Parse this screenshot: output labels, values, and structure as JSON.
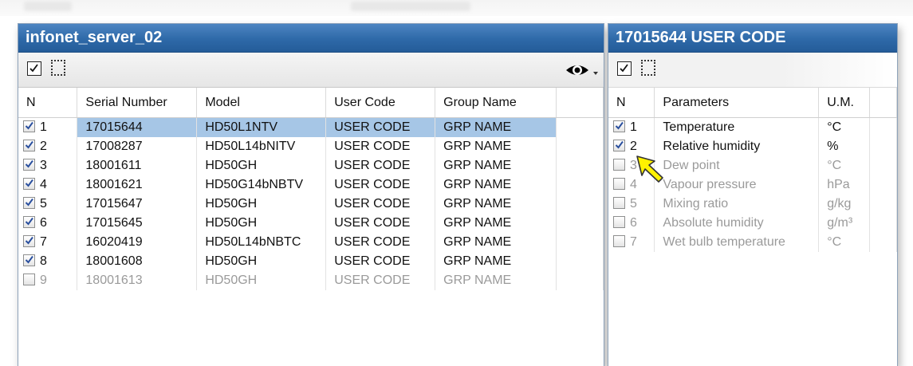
{
  "server_panel": {
    "title": "infonet_server_02",
    "columns": [
      "N",
      "Serial Number",
      "Model",
      "User Code",
      "Group Name"
    ],
    "rows": [
      {
        "n": "1",
        "checked": true,
        "serial": "17015644",
        "model": "HD50L1NTV",
        "user_code": "USER CODE",
        "group": "GRP NAME"
      },
      {
        "n": "2",
        "checked": true,
        "serial": "17008287",
        "model": "HD50L14bNITV",
        "user_code": "USER CODE",
        "group": "GRP NAME"
      },
      {
        "n": "3",
        "checked": true,
        "serial": "18001611",
        "model": "HD50GH",
        "user_code": "USER CODE",
        "group": "GRP NAME"
      },
      {
        "n": "4",
        "checked": true,
        "serial": "18001621",
        "model": "HD50G14bNBTV",
        "user_code": "USER CODE",
        "group": "GRP NAME"
      },
      {
        "n": "5",
        "checked": true,
        "serial": "17015647",
        "model": "HD50GH",
        "user_code": "USER CODE",
        "group": "GRP NAME"
      },
      {
        "n": "6",
        "checked": true,
        "serial": "17015645",
        "model": "HD50GH",
        "user_code": "USER CODE",
        "group": "GRP NAME"
      },
      {
        "n": "7",
        "checked": true,
        "serial": "16020419",
        "model": "HD50L14bNBTC",
        "user_code": "USER CODE",
        "group": "GRP NAME"
      },
      {
        "n": "8",
        "checked": true,
        "serial": "18001608",
        "model": "HD50GH",
        "user_code": "USER CODE",
        "group": "GRP NAME"
      },
      {
        "n": "9",
        "checked": false,
        "serial": "18001613",
        "model": "HD50GH",
        "user_code": "USER CODE",
        "group": "GRP NAME"
      }
    ]
  },
  "device_panel": {
    "title": "17015644 USER CODE",
    "columns": [
      "N",
      "Parameters",
      "U.M."
    ],
    "rows": [
      {
        "n": "1",
        "checked": true,
        "param": "Temperature",
        "unit": "°C"
      },
      {
        "n": "2",
        "checked": true,
        "param": "Relative humidity",
        "unit": "%"
      },
      {
        "n": "3",
        "checked": false,
        "param": "Dew point",
        "unit": "°C"
      },
      {
        "n": "4",
        "checked": false,
        "param": "Vapour pressure",
        "unit": "hPa"
      },
      {
        "n": "5",
        "checked": false,
        "param": "Mixing ratio",
        "unit": "g/kg"
      },
      {
        "n": "6",
        "checked": false,
        "param": "Absolute humidity",
        "unit": "g/m³"
      },
      {
        "n": "7",
        "checked": false,
        "param": "Wet bulb temperature",
        "unit": "°C"
      }
    ]
  },
  "colors": {
    "title_bar": "#2e69a8",
    "selected_row": "#a6c6e6",
    "cursor": "#fff200"
  },
  "icons": [
    "checkbox-select-all-icon",
    "select-none-icon",
    "eye-icon",
    "dropdown-arrow-icon",
    "checkmark-icon",
    "pointer-cursor-icon"
  ]
}
